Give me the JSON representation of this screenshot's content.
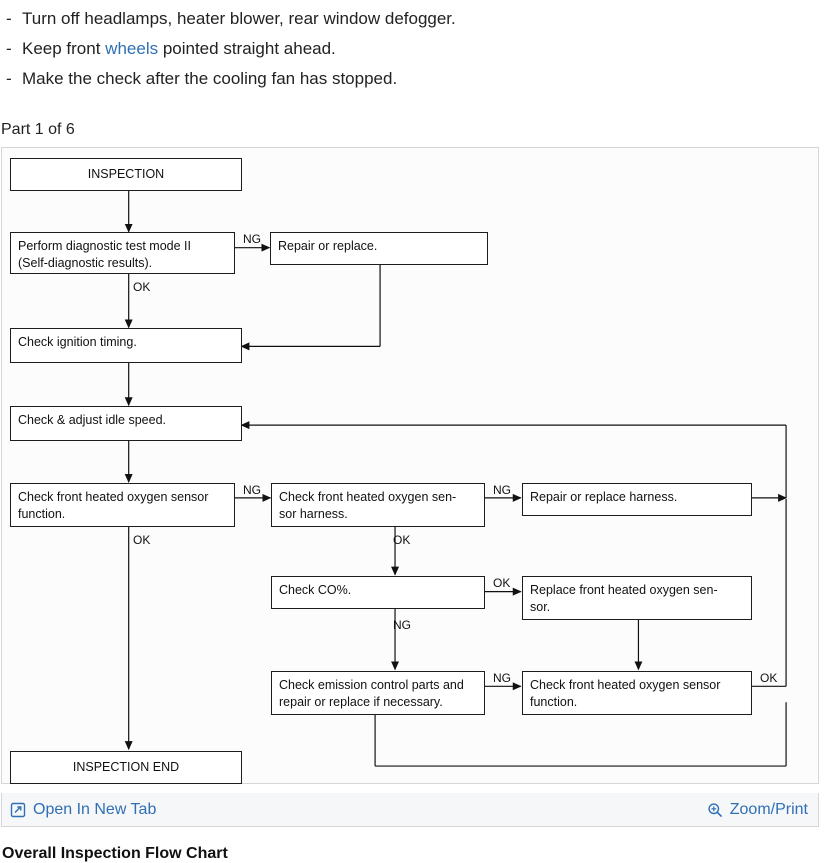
{
  "bullets": [
    {
      "dash": "-",
      "pre": "Turn off headlamps, heater blower, rear window defogger.",
      "link": "",
      "post": ""
    },
    {
      "dash": "-",
      "pre": "Keep front ",
      "link": "wheels",
      "post": " pointed straight ahead."
    },
    {
      "dash": "-",
      "pre": "Make the check after the cooling fan has stopped.",
      "link": "",
      "post": ""
    }
  ],
  "part_label": "Part 1 of 6",
  "footer": {
    "open_label": "Open In New Tab",
    "open_icon": "open-in-new-tab-icon",
    "zoom_label": "Zoom/Print",
    "zoom_icon": "magnifier-icon"
  },
  "caption": "Overall Inspection Flow Chart",
  "chart_data": {
    "type": "diagram",
    "title": "Overall Inspection Flow Chart",
    "nodes": [
      {
        "id": "n1",
        "text": "INSPECTION",
        "align": "center"
      },
      {
        "id": "n2",
        "text": "Perform diagnostic test mode II\n(Self-diagnostic results)."
      },
      {
        "id": "n3",
        "text": "Repair or replace."
      },
      {
        "id": "n4",
        "text": "Check ignition timing."
      },
      {
        "id": "n5",
        "text": "Check & adjust idle speed."
      },
      {
        "id": "n6",
        "text": "Check front heated oxygen sensor\nfunction."
      },
      {
        "id": "n7",
        "text": "Check front heated oxygen sen-\nsor harness."
      },
      {
        "id": "n8",
        "text": "Repair or replace harness."
      },
      {
        "id": "n9",
        "text": "Check CO%."
      },
      {
        "id": "n10",
        "text": "Replace front heated oxygen sen-\nsor."
      },
      {
        "id": "n11",
        "text": "Check emission control parts and\nrepair or replace if necessary."
      },
      {
        "id": "n12",
        "text": "Check front heated oxygen sensor\nfunction."
      },
      {
        "id": "n13",
        "text": "INSPECTION END",
        "align": "center"
      }
    ],
    "edge_labels": [
      "NG",
      "OK",
      "NG",
      "OK",
      "NG",
      "OK",
      "NG",
      "OK",
      "NG",
      "OK"
    ]
  }
}
